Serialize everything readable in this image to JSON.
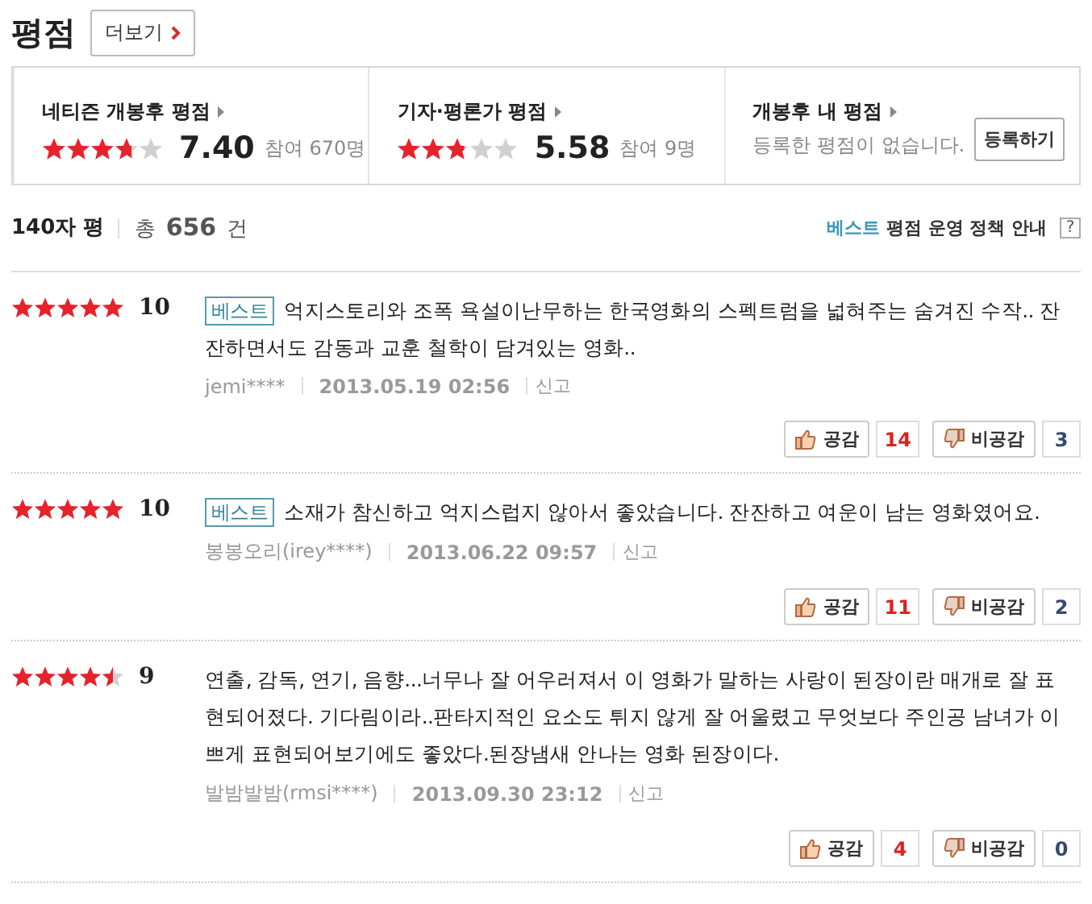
{
  "title": "평점",
  "more_button": "더보기",
  "summary": [
    {
      "kind": "rating",
      "title": "네티즌 개봉후 평점",
      "stars": 3.7,
      "score": "7.40",
      "participants": "참여 670명"
    },
    {
      "kind": "rating",
      "title": "기자·평론가 평점",
      "stars": 2.79,
      "score": "5.58",
      "participants": "참여 9명"
    },
    {
      "kind": "mine",
      "title": "개봉후 내 평점",
      "message": "등록한 평점이 없습니다.",
      "button": "등록하기"
    }
  ],
  "list_header": {
    "label": "140자 평",
    "total": "총 **656** 건",
    "best_label": "베스트",
    "policy_label": "평점 운영 정책 안내",
    "help": "?"
  },
  "reviews": [
    {
      "stars": 5,
      "score": "10",
      "badge": "베스트",
      "text": "억지스토리와 조폭 욕설이난무하는 한국영화의 스펙트럼을 넓혀주는 숨겨진 수작.. 잔잔하면서도 감동과 교훈 철학이 담겨있는 영화..",
      "user": "jemi****",
      "date": "2013.05.19 02:56",
      "report": "신고",
      "like_label": "공감",
      "like_count": "14",
      "dislike_label": "비공감",
      "dislike_count": "3"
    },
    {
      "stars": 5,
      "score": "10",
      "badge": "베스트",
      "text": "소재가 참신하고 억지스럽지 않아서 좋았습니다. 잔잔하고 여운이 남는 영화였어요.",
      "user": "봉봉오리(irey****)",
      "date": "2013.06.22 09:57",
      "report": "신고",
      "like_label": "공감",
      "like_count": "11",
      "dislike_label": "비공감",
      "dislike_count": "2"
    },
    {
      "stars": 4.5,
      "score": "9",
      "text": "연출, 감독, 연기, 음향...너무나 잘 어우러져서 이 영화가 말하는 사랑이 된장이란 매개로 잘 표현되어졌다. 기다림이라..판타지적인 요소도 튀지 않게 잘 어울렸고 무엇보다 주인공 남녀가 이쁘게 표현되어보기에도 좋았다.된장냄새 안나는 영화 된장이다.",
      "user": "발밤발밤(rmsi****)",
      "date": "2013.09.30 23:12",
      "report": "신고",
      "like_label": "공감",
      "like_count": "4",
      "dislike_label": "비공감",
      "dislike_count": "0"
    }
  ]
}
